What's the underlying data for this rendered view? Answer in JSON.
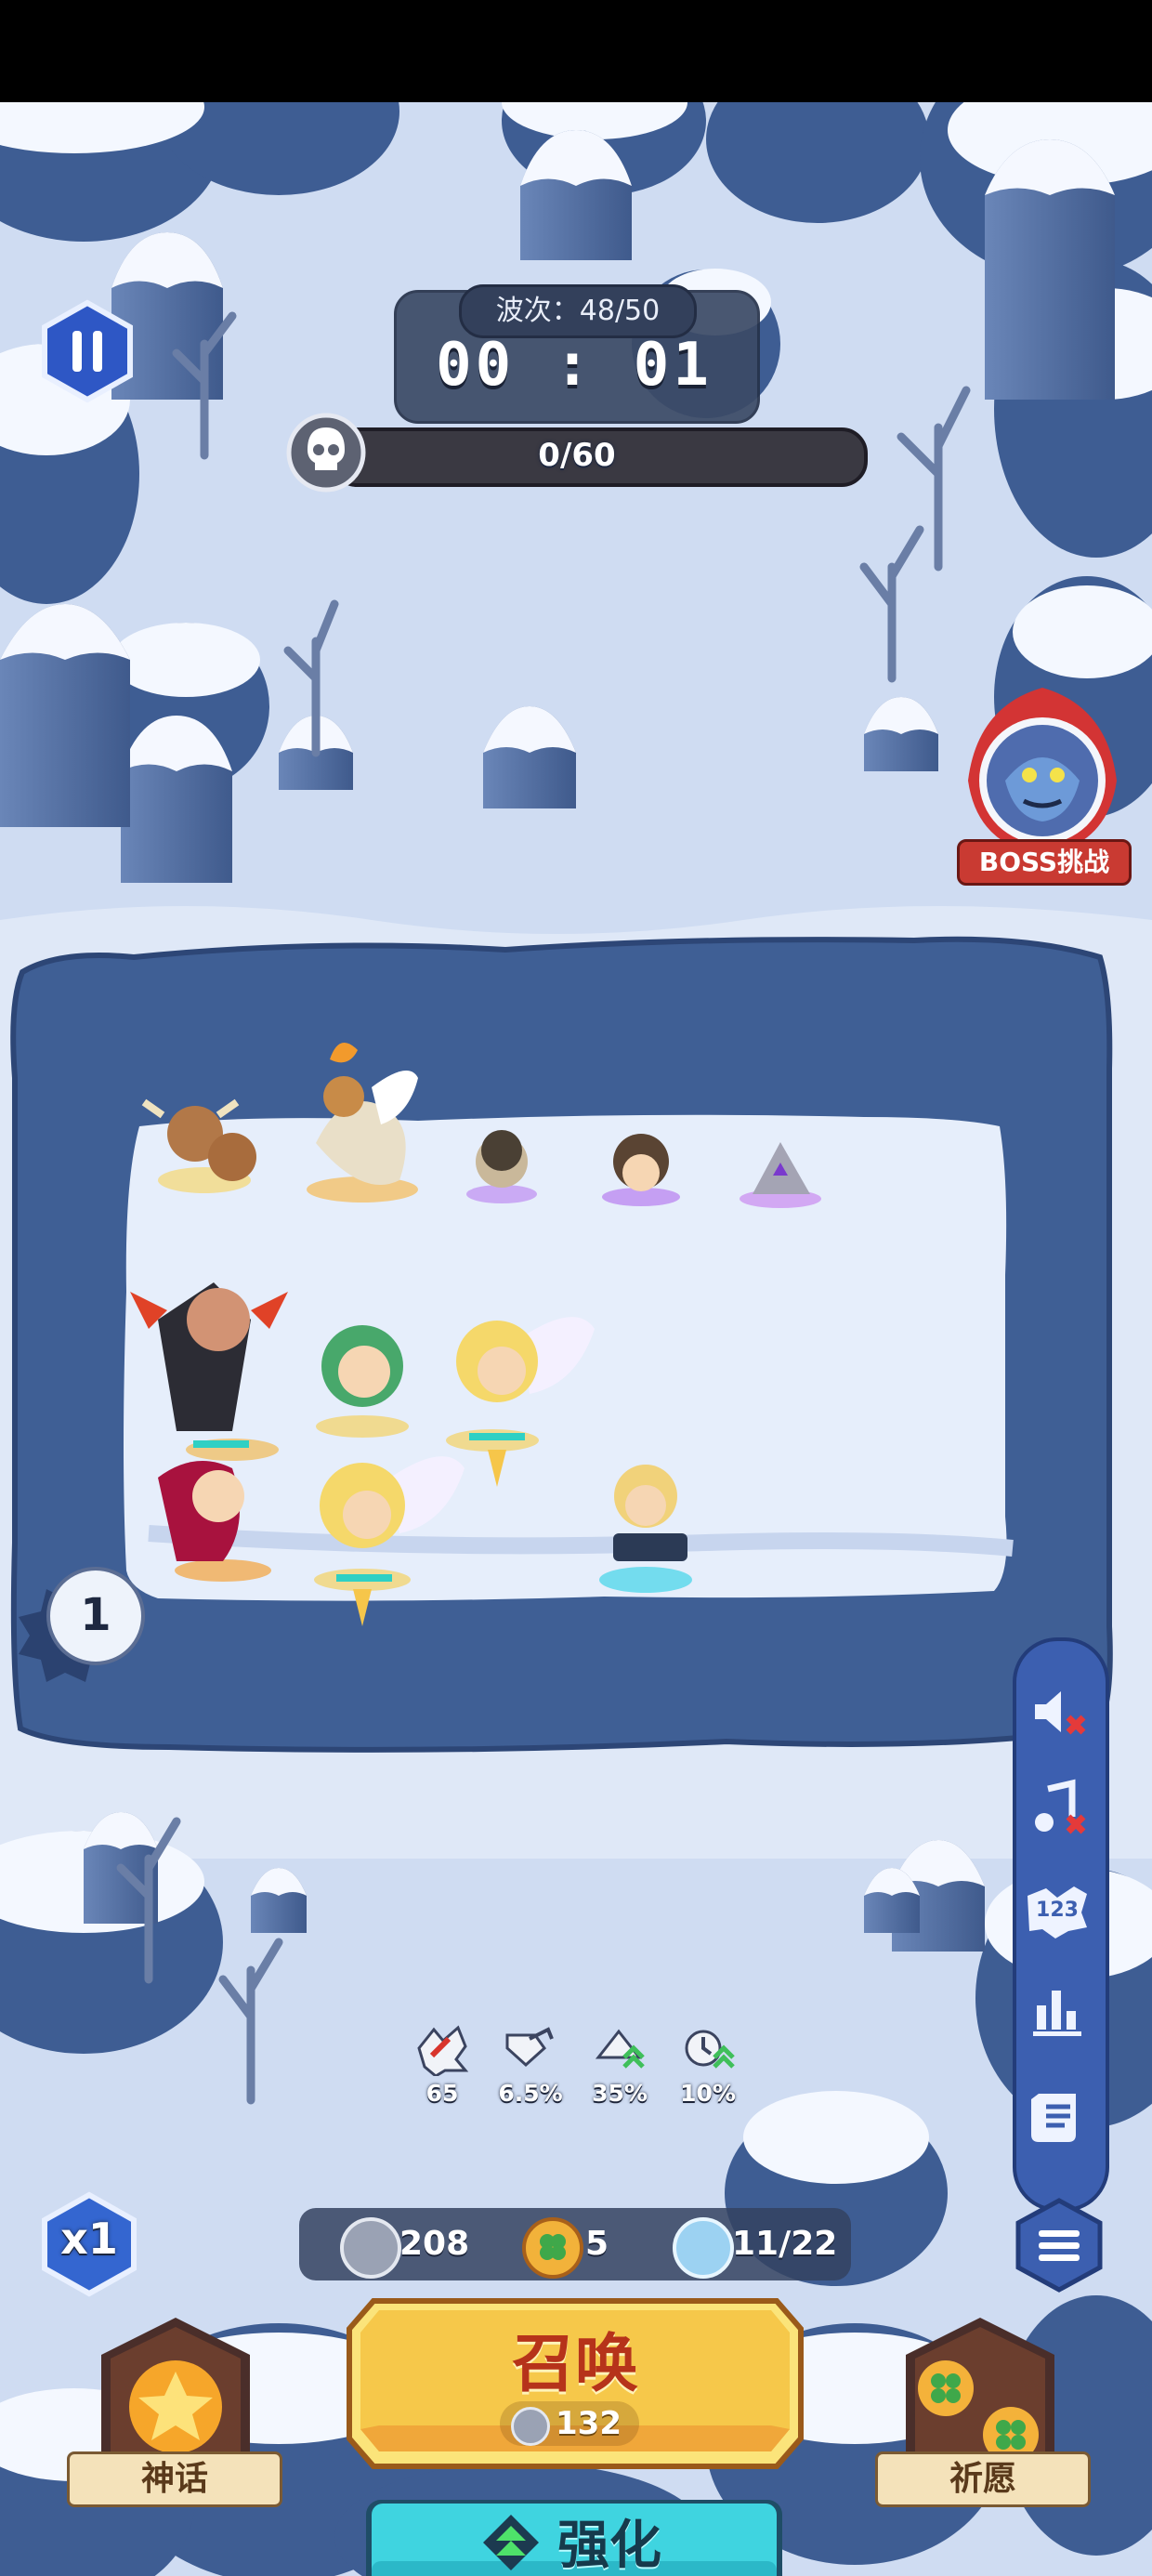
{
  "hud": {
    "wave_label": "波次：48/50",
    "timer": "00 : 01",
    "kill_progress": "0/60",
    "kills_fraction": 0
  },
  "boss": {
    "label": "BOSS挑战"
  },
  "bubble": {
    "count": "1"
  },
  "speed": {
    "label": "x1"
  },
  "side_menu": {
    "items": [
      "sound-muted-icon",
      "music-muted-icon",
      "damage-numbers-icon",
      "stats-chart-icon",
      "scroll-icon"
    ]
  },
  "stats": [
    {
      "icon": "attack-icon",
      "value": "65"
    },
    {
      "icon": "crit-icon",
      "value": "6.5%"
    },
    {
      "icon": "speed-up-icon",
      "value": "35%"
    },
    {
      "icon": "cooldown-icon",
      "value": "10%"
    }
  ],
  "resources": {
    "silver": "208",
    "clover": "5",
    "units": "11/22"
  },
  "summon": {
    "label": "召唤",
    "cost": "132"
  },
  "upgrade": {
    "label": "强化"
  },
  "myth": {
    "label": "神话"
  },
  "wish": {
    "label": "祈愿"
  },
  "colors": {
    "snow": "#dfe8f7",
    "pit": "#3f5f95",
    "pit_edge": "#2d4676",
    "field": "#e6eefb",
    "summon_gold": "#f6c84a",
    "upgrade_cyan": "#3fd4e0",
    "menu_blue": "#3c5fb0"
  }
}
